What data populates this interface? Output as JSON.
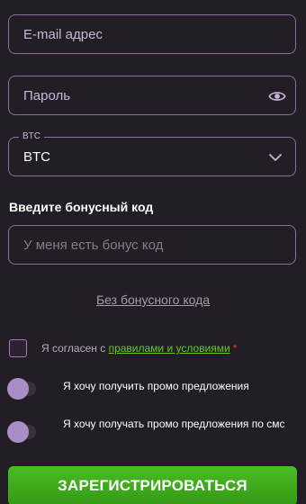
{
  "form": {
    "email_placeholder": "E-mail адрес",
    "password_placeholder": "Пароль",
    "currency": {
      "label": "BTC",
      "selected": "BTC"
    },
    "bonus_heading": "Введите бонусный код",
    "bonus_placeholder": "У меня есть бонус код",
    "no_bonus_link": "Без бонусного кода",
    "agree": {
      "prefix": "Я согласен с ",
      "link": "правилами и условиями",
      "required_mark": "*"
    },
    "promo_toggle_label": "Я хочу получить промо предложения",
    "sms_toggle_label": "Я хочу получать промо предложения по смс",
    "submit_label": "ЗАРЕГИСТРИРОВАТЬСЯ"
  },
  "icons": {
    "password_toggle": "eye-icon",
    "currency_dropdown": "chevron-down-icon"
  },
  "colors": {
    "background": "#231d25",
    "field_border": "#8a6ea8",
    "accent_green": "#4bbc22",
    "link_green": "#64c92a",
    "toggle_knob": "#a78ec4",
    "required_red": "#e23c3c"
  },
  "state": {
    "agree_checked": false,
    "promo_enabled": false,
    "sms_enabled": false
  }
}
